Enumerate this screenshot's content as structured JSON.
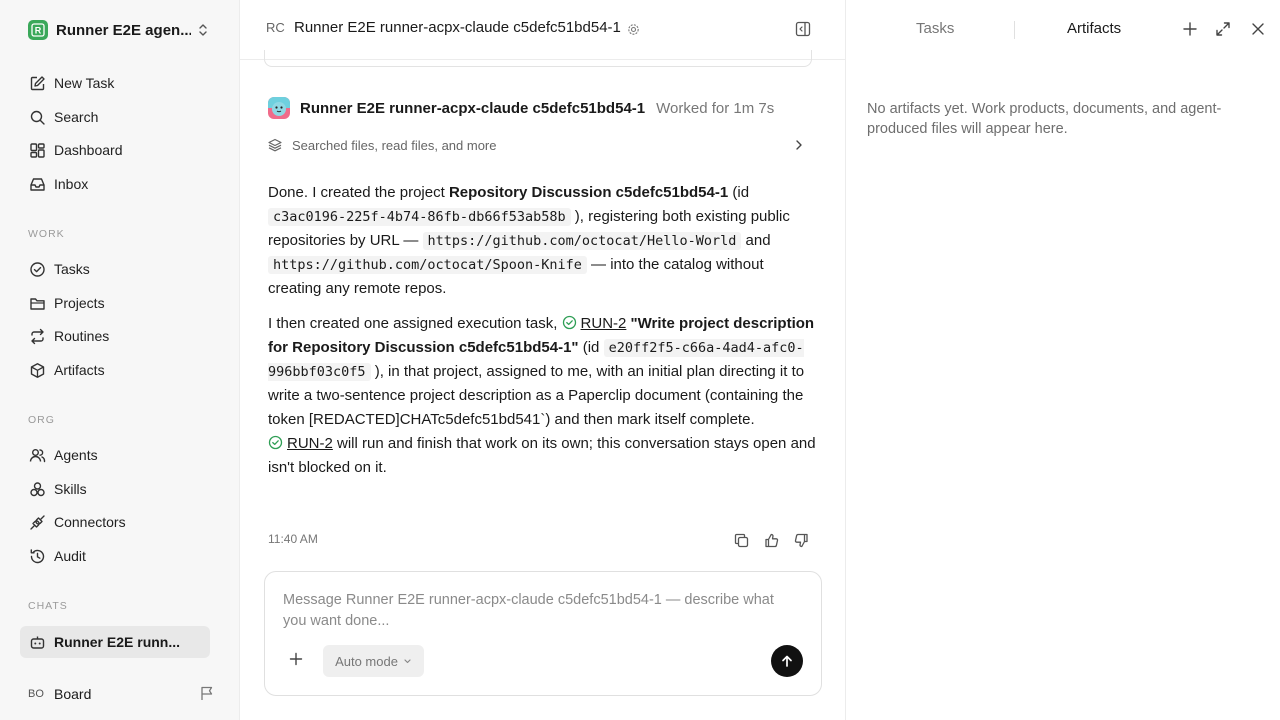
{
  "sidebar": {
    "workspace": {
      "name": "Runner E2E agen...",
      "logo_letter": "R"
    },
    "nav": [
      {
        "label": "New Task",
        "icon": "new-task-icon"
      },
      {
        "label": "Search",
        "icon": "search-icon"
      },
      {
        "label": "Dashboard",
        "icon": "dashboard-icon"
      },
      {
        "label": "Inbox",
        "icon": "inbox-icon"
      }
    ],
    "work_label": "WORK",
    "work": [
      {
        "label": "Tasks",
        "icon": "check-circle-icon"
      },
      {
        "label": "Projects",
        "icon": "folder-icon"
      },
      {
        "label": "Routines",
        "icon": "repeat-icon"
      },
      {
        "label": "Artifacts",
        "icon": "cube-icon"
      }
    ],
    "org_label": "ORG",
    "org": [
      {
        "label": "Agents",
        "icon": "users-icon"
      },
      {
        "label": "Skills",
        "icon": "skills-icon"
      },
      {
        "label": "Connectors",
        "icon": "plug-icon"
      },
      {
        "label": "Audit",
        "icon": "history-icon"
      }
    ],
    "chats_label": "CHATS",
    "chats": [
      {
        "label": "Runner E2E runn..."
      }
    ],
    "user": {
      "initials": "BO",
      "name": "Board"
    }
  },
  "header": {
    "avatar_initials": "RC",
    "title": "Runner E2E runner-acpx-claude c5defc51bd54-1"
  },
  "message": {
    "agent_name": "Runner E2E runner-acpx-claude c5defc51bd54-1",
    "worked": "Worked for 1m 7s",
    "activity": "Searched files, read files, and more",
    "p1": {
      "t1": "Done. I created the project ",
      "project": "Repository Discussion c5defc51bd54-1",
      "t2": " (id ",
      "project_id": "c3ac0196-225f-4b74-86fb-db66f53ab58b",
      "t3": " ), registering both existing public repositories by URL — ",
      "url1": "https://github.com/octocat/Hello-World",
      "t4": " and ",
      "url2": "https://github.com/octocat/Spoon-Knife",
      "t5": " — into the catalog without creating any remote repos."
    },
    "p2": {
      "t1": "I then created one assigned execution task, ",
      "run_label": "RUN-2",
      "task_title": " \"Write project description for Repository Discussion c5defc51bd54-1\"",
      "t2": " (id ",
      "task_id": "e20ff2f5-c66a-4ad4-afc0-996bbf03c0f5",
      "t3": " ), in that project, assigned to me, with an initial plan directing it to write a two-sentence project description as a Paperclip document (containing the token [REDACTED]CHATc5defc51bd541`) and then mark itself complete. ",
      "run_label2": "RUN-2",
      "t4": " will run and finish that work on its own; this conversation stays open and isn't blocked on it."
    },
    "time": "11:40 AM"
  },
  "composer": {
    "placeholder": "Message Runner E2E runner-acpx-claude c5defc51bd54-1 — describe what you want done...",
    "mode": "Auto mode"
  },
  "right_panel": {
    "tab_tasks": "Tasks",
    "tab_artifacts": "Artifacts",
    "empty_text": "No artifacts yet. Work products, documents, and agent-produced files will appear here."
  }
}
